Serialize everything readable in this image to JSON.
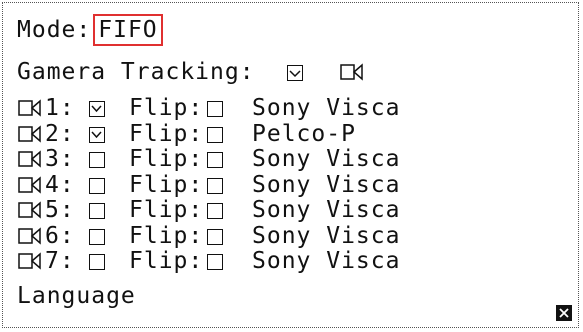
{
  "mode": {
    "label": "Mode:",
    "value": "FIFO",
    "highlight_color": "#e03030"
  },
  "tracking": {
    "label": "Gamera Tracking:",
    "checked": false,
    "icon": "camera-icon"
  },
  "cameras": [
    {
      "index": "1:",
      "enabled": true,
      "flip_label": "Flip:",
      "flip": false,
      "protocol": "Sony Visca"
    },
    {
      "index": "2:",
      "enabled": true,
      "flip_label": "Flip:",
      "flip": false,
      "protocol": "Pelco-P"
    },
    {
      "index": "3:",
      "enabled": false,
      "flip_label": "Flip:",
      "flip": false,
      "protocol": "Sony Visca"
    },
    {
      "index": "4:",
      "enabled": false,
      "flip_label": "Flip:",
      "flip": false,
      "protocol": "Sony Visca"
    },
    {
      "index": "5:",
      "enabled": false,
      "flip_label": "Flip:",
      "flip": false,
      "protocol": "Sony Visca"
    },
    {
      "index": "6:",
      "enabled": false,
      "flip_label": "Flip:",
      "flip": false,
      "protocol": "Sony Visca"
    },
    {
      "index": "7:",
      "enabled": false,
      "flip_label": "Flip:",
      "flip": false,
      "protocol": "Sony Visca"
    }
  ],
  "language": {
    "label": "Language"
  },
  "close_icon": "close-icon"
}
